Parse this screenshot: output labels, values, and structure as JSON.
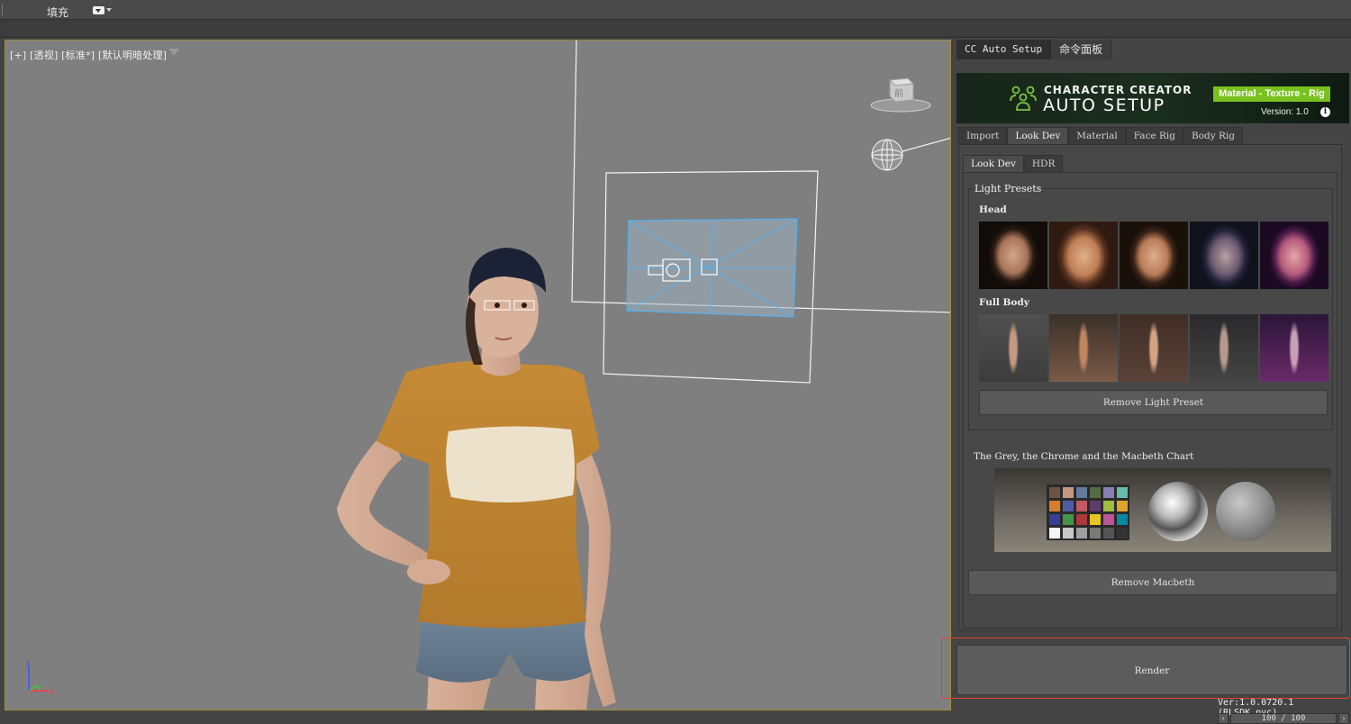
{
  "topbar": {
    "fill_label": "填充"
  },
  "viewport": {
    "label": "[+] [透视] [标准*] [默认明暗处理]"
  },
  "panel": {
    "tabs": [
      {
        "label": "CC Auto Setup"
      },
      {
        "label": "命令面板"
      }
    ],
    "banner": {
      "line1": "CHARACTER CREATOR",
      "line2": "AUTO SETUP",
      "badge": "Material - Texture - Rig",
      "version": "Version: 1.0"
    },
    "main_tabs": [
      {
        "label": "Import"
      },
      {
        "label": "Look Dev"
      },
      {
        "label": "Material"
      },
      {
        "label": "Face Rig"
      },
      {
        "label": "Body Rig"
      }
    ],
    "sub_tabs": [
      {
        "label": "Look Dev"
      },
      {
        "label": "HDR"
      }
    ],
    "light_presets": {
      "title": "Light Presets",
      "head_label": "Head",
      "full_body_label": "Full Body",
      "remove_label": "Remove Light Preset"
    },
    "chart_label": "The Grey, the Chrome and the Macbeth Chart",
    "remove_macbeth_label": "Remove Macbeth",
    "render_label": "Render",
    "version_line": "Ver:1.0.0720.1 (RLSDK.pyc)",
    "pager": {
      "value": "100 / 100"
    }
  },
  "colors": {
    "accent_green": "#78c11f",
    "highlight": "#e0442a",
    "viewport_bg": "#7f7f7f"
  }
}
